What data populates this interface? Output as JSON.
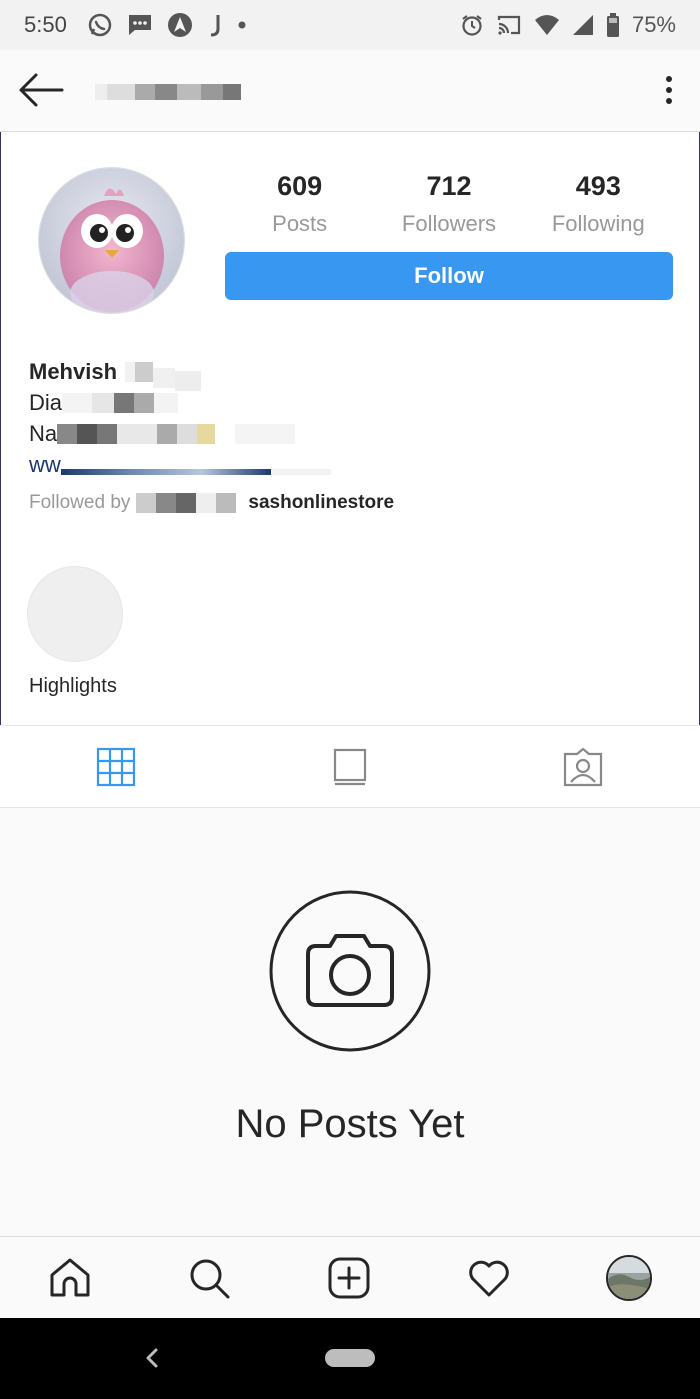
{
  "status_bar": {
    "time": "5:50",
    "battery": "75%",
    "icons_left": [
      "whatsapp-icon",
      "messages-icon",
      "navigation-icon",
      "j-app-icon",
      "dot-icon"
    ],
    "icons_right": [
      "alarm-icon",
      "cast-icon",
      "wifi-icon",
      "cell-signal-icon",
      "battery-icon"
    ]
  },
  "app_bar": {
    "title": "",
    "back_icon": "arrow-left-icon",
    "menu_icon": "more-vertical-icon"
  },
  "profile": {
    "stats": [
      {
        "value": "609",
        "label": "Posts"
      },
      {
        "value": "712",
        "label": "Followers"
      },
      {
        "value": "493",
        "label": "Following"
      }
    ],
    "follow_label": "Follow",
    "name": "Mehvish",
    "bio_line_1": "Dia",
    "bio_line_2": "Na",
    "link": "ww",
    "followed_by_label": "Followed by",
    "followed_by_user": "sashonlinestore"
  },
  "highlights": {
    "label": "Highlights"
  },
  "tabs": [
    {
      "icon": "grid-icon",
      "active": true
    },
    {
      "icon": "feed-icon",
      "active": false
    },
    {
      "icon": "tagged-icon",
      "active": false
    }
  ],
  "empty_state": {
    "icon": "camera-icon",
    "text": "No Posts Yet"
  },
  "bottom_nav": [
    {
      "icon": "home-icon"
    },
    {
      "icon": "search-icon"
    },
    {
      "icon": "add-post-icon"
    },
    {
      "icon": "heart-icon"
    },
    {
      "icon": "profile-avatar"
    }
  ],
  "colors": {
    "accent": "#3897f0",
    "text": "#262626",
    "muted": "#999999",
    "background": "#fafafa"
  }
}
